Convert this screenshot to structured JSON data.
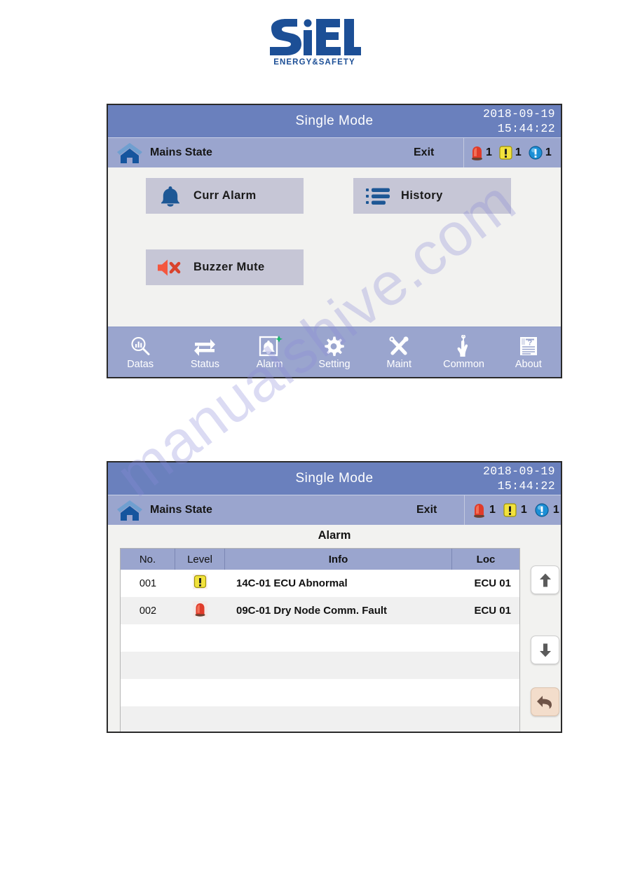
{
  "logo": {
    "brand": "SiEL",
    "tagline": "ENERGY&SAFETY",
    "color": "#1c4f96"
  },
  "watermark": {
    "text": "manualshive.com"
  },
  "colors": {
    "titlebar": "#6a80bd",
    "subheader": "#9aa5ce",
    "navbar": "#9aa5ce",
    "panel_body": "#f2f2f0",
    "button_face": "#c6c6d6",
    "alarm_red": "#e03b2a",
    "warn_yellow": "#f2e23c",
    "info_blue": "#1b8fd6",
    "accent_blue": "#1a5794",
    "back_button": "#f3ddcb"
  },
  "screens": [
    {
      "id": "alarm-menu",
      "header": {
        "mode": "Single Mode",
        "date": "2018-09-19",
        "time": "15:44:22",
        "home_icon": "home-icon",
        "state": "Mains State",
        "exit": "Exit",
        "badges": [
          {
            "icon": "alarm-beacon-icon",
            "count": "1"
          },
          {
            "icon": "warning-triangle-icon",
            "count": "1"
          },
          {
            "icon": "info-circle-icon",
            "count": "1"
          }
        ]
      },
      "buttons": [
        {
          "label": "Curr Alarm",
          "icon": "bell-icon"
        },
        {
          "label": "History",
          "icon": "list-icon"
        },
        {
          "label": "Buzzer Mute",
          "icon": "speaker-mute-icon"
        }
      ]
    },
    {
      "id": "alarm-list",
      "header": {
        "mode": "Single Mode",
        "date": "2018-09-19",
        "time": "15:44:22",
        "home_icon": "home-icon",
        "state": "Mains State",
        "exit": "Exit",
        "badges": [
          {
            "icon": "alarm-beacon-icon",
            "count": "1"
          },
          {
            "icon": "warning-triangle-icon",
            "count": "1"
          },
          {
            "icon": "info-circle-icon",
            "count": "1"
          }
        ]
      },
      "title": "Alarm",
      "table": {
        "columns": [
          "No.",
          "Level",
          "Info",
          "Loc"
        ],
        "rows": [
          {
            "no": "001",
            "level_icon": "warning-square-icon",
            "info": "14C-01 ECU Abnormal",
            "loc": "ECU 01"
          },
          {
            "no": "002",
            "level_icon": "alarm-beacon-icon",
            "info": "09C-01 Dry Node Comm.  Fault",
            "loc": "ECU 01"
          }
        ],
        "empty_rows": 4
      },
      "side_buttons": [
        {
          "name": "scroll-up-button",
          "icon": "arrow-up-icon"
        },
        {
          "name": "scroll-down-button",
          "icon": "arrow-down-icon"
        },
        {
          "name": "back-button",
          "icon": "back-arrow-icon"
        }
      ]
    }
  ],
  "navbar": {
    "items": [
      {
        "label": "Datas",
        "icon": "data-search-icon",
        "active": false
      },
      {
        "label": "Status",
        "icon": "transfer-icon",
        "active": false
      },
      {
        "label": "Alarm",
        "icon": "bell-square-icon",
        "active": true
      },
      {
        "label": "Setting",
        "icon": "gear-icon",
        "active": false
      },
      {
        "label": "Maint",
        "icon": "tools-icon",
        "active": false
      },
      {
        "label": "Common",
        "icon": "hand-pointer-icon",
        "active": false
      },
      {
        "label": "About",
        "icon": "document-help-icon",
        "active": false
      }
    ]
  }
}
